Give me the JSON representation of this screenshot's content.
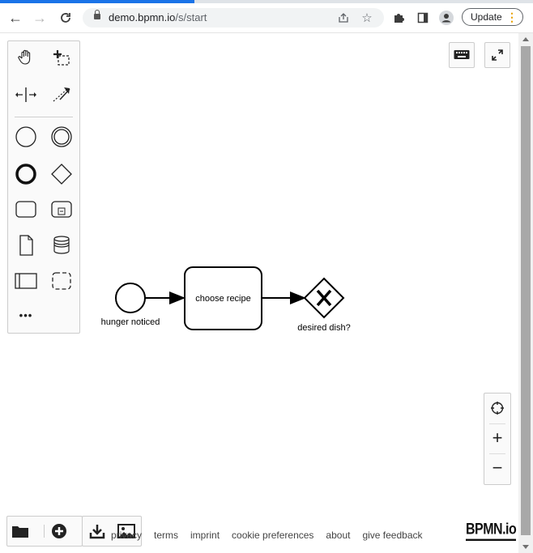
{
  "browser": {
    "url_host": "demo.bpmn.io",
    "url_path": "/s/start",
    "update_label": "Update"
  },
  "diagram": {
    "start_event_label": "hunger noticed",
    "task_label": "choose recipe",
    "gateway_label": "desired dish?"
  },
  "zoom": {
    "reset": "⊕",
    "in": "+",
    "out": "−"
  },
  "footer": {
    "links": [
      "privacy",
      "terms",
      "imprint",
      "cookie preferences",
      "about",
      "give feedback"
    ],
    "brand": "BPMN.io"
  },
  "palette": {
    "more": "•••"
  }
}
